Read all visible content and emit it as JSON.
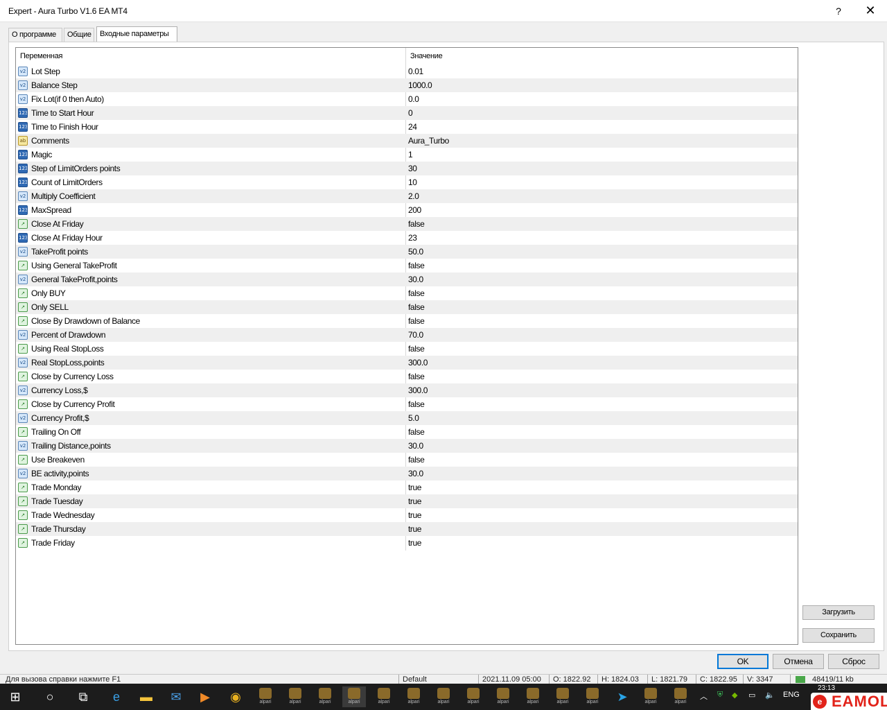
{
  "window": {
    "title": "Expert - Aura Turbo V1.6 EA MT4",
    "help": "?",
    "close": "✕"
  },
  "tabs": [
    {
      "label": "О программе"
    },
    {
      "label": "Общие"
    },
    {
      "label": "Входные параметры"
    }
  ],
  "table": {
    "headers": {
      "name": "Переменная",
      "value": "Значение"
    },
    "rows": [
      {
        "type": "double",
        "icon": "v2",
        "name": "Lot Step",
        "value": "0.01"
      },
      {
        "type": "double",
        "icon": "v2",
        "name": "Balance Step",
        "value": "1000.0"
      },
      {
        "type": "double",
        "icon": "v2",
        "name": "Fix Lot(if 0 then Auto)",
        "value": "0.0"
      },
      {
        "type": "int",
        "icon": "123",
        "name": "Time to Start Hour",
        "value": "0"
      },
      {
        "type": "int",
        "icon": "123",
        "name": "Time to Finish Hour",
        "value": "24"
      },
      {
        "type": "string",
        "icon": "ab",
        "name": "Comments",
        "value": "Aura_Turbo"
      },
      {
        "type": "int",
        "icon": "123",
        "name": "Magic",
        "value": "1"
      },
      {
        "type": "int",
        "icon": "123",
        "name": "Step of LimitOrders points",
        "value": "30"
      },
      {
        "type": "int",
        "icon": "123",
        "name": "Count of LimitOrders",
        "value": "10"
      },
      {
        "type": "double",
        "icon": "v2",
        "name": "Multiply Coefficient",
        "value": "2.0"
      },
      {
        "type": "int",
        "icon": "123",
        "name": "MaxSpread",
        "value": "200"
      },
      {
        "type": "bool",
        "icon": "↗",
        "name": "Close At Friday",
        "value": "false"
      },
      {
        "type": "int",
        "icon": "123",
        "name": "Close At Friday Hour",
        "value": "23"
      },
      {
        "type": "double",
        "icon": "v2",
        "name": "TakeProfit points",
        "value": "50.0"
      },
      {
        "type": "bool",
        "icon": "↗",
        "name": "Using General TakeProfit",
        "value": "false"
      },
      {
        "type": "double",
        "icon": "v2",
        "name": "General TakeProfit,points",
        "value": "30.0"
      },
      {
        "type": "bool",
        "icon": "↗",
        "name": "Only BUY",
        "value": "false"
      },
      {
        "type": "bool",
        "icon": "↗",
        "name": "Only SELL",
        "value": "false"
      },
      {
        "type": "bool",
        "icon": "↗",
        "name": "Close By Drawdown of Balance",
        "value": "false"
      },
      {
        "type": "double",
        "icon": "v2",
        "name": "Percent of Drawdown",
        "value": "70.0"
      },
      {
        "type": "bool",
        "icon": "↗",
        "name": "Using Real StopLoss",
        "value": "false"
      },
      {
        "type": "double",
        "icon": "v2",
        "name": "Real StopLoss,points",
        "value": "300.0"
      },
      {
        "type": "bool",
        "icon": "↗",
        "name": "Close by Currency Loss",
        "value": "false"
      },
      {
        "type": "double",
        "icon": "v2",
        "name": "Currency Loss,$",
        "value": "300.0"
      },
      {
        "type": "bool",
        "icon": "↗",
        "name": "Close by Currency Profit",
        "value": "false"
      },
      {
        "type": "double",
        "icon": "v2",
        "name": "Currency Profit,$",
        "value": "5.0"
      },
      {
        "type": "bool",
        "icon": "↗",
        "name": "Trailing On Off",
        "value": "false"
      },
      {
        "type": "double",
        "icon": "v2",
        "name": "Trailing Distance,points",
        "value": "30.0"
      },
      {
        "type": "bool",
        "icon": "↗",
        "name": "Use Breakeven",
        "value": "false"
      },
      {
        "type": "double",
        "icon": "v2",
        "name": "BE activity,points",
        "value": "30.0"
      },
      {
        "type": "bool",
        "icon": "↗",
        "name": "Trade Monday",
        "value": "true"
      },
      {
        "type": "bool",
        "icon": "↗",
        "name": "Trade Tuesday",
        "value": "true"
      },
      {
        "type": "bool",
        "icon": "↗",
        "name": "Trade Wednesday",
        "value": "true"
      },
      {
        "type": "bool",
        "icon": "↗",
        "name": "Trade Thursday",
        "value": "true"
      },
      {
        "type": "bool",
        "icon": "↗",
        "name": "Trade Friday",
        "value": "true"
      }
    ]
  },
  "side_buttons": {
    "load": "Загрузить",
    "save": "Сохранить"
  },
  "bottom_buttons": {
    "ok": "OK",
    "cancel": "Отмена",
    "reset": "Сброс"
  },
  "statusbar": {
    "help_hint": "Для вызова справки нажмите F1",
    "profile": "Default",
    "datetime": "2021.11.09 05:00",
    "open": "O: 1822.92",
    "high": "H: 1824.03",
    "low": "L: 1821.79",
    "close": "C: 1822.95",
    "volume": "V: 3347",
    "traffic": "48419/11 kb"
  },
  "taskbar": {
    "app_label": "alpari",
    "lang": "ENG",
    "time": "23:13",
    "watermark": "EAMOL",
    "icons": [
      "windows-start-icon",
      "search-icon",
      "task-view-icon",
      "edge-icon",
      "file-explorer-icon",
      "mail-icon",
      "media-player-icon",
      "chrome-icon",
      "telegram-icon"
    ]
  },
  "colors": {
    "selected_tab": "#ffffff",
    "alt_row": "#efefef",
    "default_button_border": "#0078d7",
    "taskbar": "#1c1c1c",
    "brand": "#e2231a"
  }
}
